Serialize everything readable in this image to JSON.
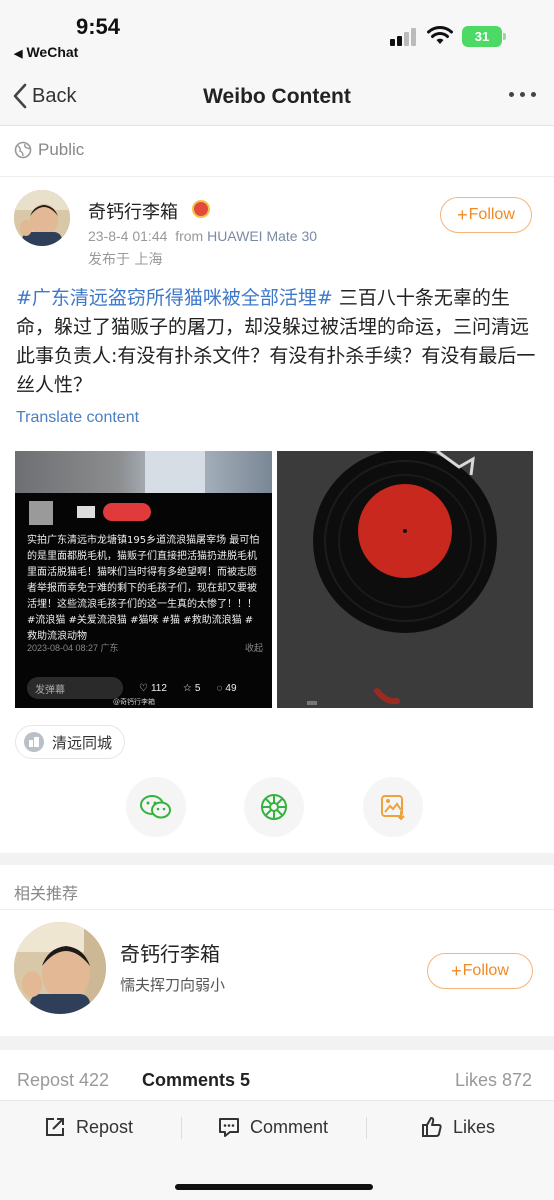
{
  "status_bar": {
    "time": "9:54",
    "back_app": "WeChat",
    "battery": "31"
  },
  "nav": {
    "back_label": "Back",
    "title": "Weibo Content"
  },
  "visibility": "Public",
  "post": {
    "username": "奇钙行李箱",
    "date": "23-8-4 01:44",
    "from_label": "from",
    "device": "HUAWEI Mate 30",
    "location": "发布于 上海",
    "follow_label": "Follow",
    "hashtag": "#广东清远盗窃所得猫咪被全部活埋#",
    "text": "三百八十条无辜的生命，躲过了猫贩子的屠刀，却没躲过被活埋的命运，三问清远此事负责人:有没有扑杀文件？有没有扑杀手续？有没有最后一丝人性？",
    "translate_label": "Translate content",
    "location_tag": "清远同城"
  },
  "image1": {
    "caption": "实拍广东清远市龙塘镇195乡道流浪猫屠宰场 最可怕的是里面都脱毛机，猫贩子们直接把活猫扔进脱毛机里面活脱猫毛！猫咪们当时得有多绝望啊！而被志愿者举报而幸免于难的剩下的毛孩子们，现在却又要被活埋！这些流浪毛孩子们的这一生真的太惨了！！！#流浪猫 #关爱流浪猫 #猫咪 #猫 #救助流浪猫 #救助流浪动物",
    "date": "2023-08-04 08:27 广东",
    "collapse": "收起",
    "danmu": "发弹幕",
    "likes": "112",
    "favs": "5",
    "comments": "49",
    "watermark": "@奇钙行李箱"
  },
  "related": {
    "title": "相关推荐",
    "name": "奇钙行李箱",
    "desc": "懦夫挥刀向弱小",
    "follow_label": "Follow"
  },
  "stats": {
    "repost": "Repost 422",
    "comments": "Comments 5",
    "likes": "Likes 872"
  },
  "bottom_bar": {
    "repost": "Repost",
    "comment": "Comment",
    "likes": "Likes"
  },
  "colors": {
    "accent_orange": "#f08a27",
    "link_blue": "#3d78c9",
    "battery_green": "#4cd964",
    "record_red": "#c8281e"
  }
}
